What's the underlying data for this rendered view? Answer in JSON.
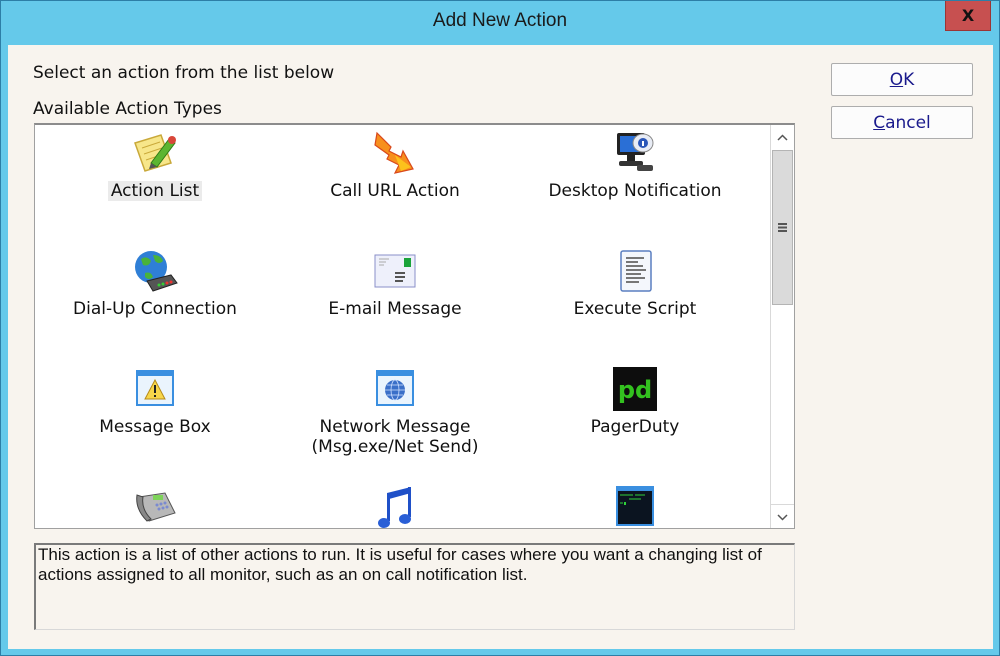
{
  "window": {
    "title": "Add New Action",
    "close_label": "X"
  },
  "instructions": "Select an action from the list below",
  "list_label": "Available Action Types",
  "buttons": {
    "ok": {
      "accel": "O",
      "rest": "K"
    },
    "cancel": {
      "accel": "C",
      "rest": "ancel"
    }
  },
  "actions": [
    {
      "label": "Action List",
      "icon": "notepad-pencil-icon",
      "selected": true
    },
    {
      "label": "Call URL Action",
      "icon": "lightning-arrow-icon"
    },
    {
      "label": "Desktop Notification",
      "icon": "monitor-info-icon"
    },
    {
      "label": "Dial-Up Connection",
      "icon": "globe-modem-icon"
    },
    {
      "label": "E-mail Message",
      "icon": "envelope-icon"
    },
    {
      "label": "Execute Script",
      "icon": "script-document-icon"
    },
    {
      "label": "Message Box",
      "icon": "warning-window-icon"
    },
    {
      "label": "Network Message\n(Msg.exe/Net Send)",
      "icon": "globe-window-icon"
    },
    {
      "label": "PagerDuty",
      "icon": "pagerduty-logo-icon"
    },
    {
      "label": "",
      "icon": "telephone-icon"
    },
    {
      "label": "",
      "icon": "music-note-icon"
    },
    {
      "label": "",
      "icon": "console-window-icon"
    }
  ],
  "description": "This action is a list of other actions to run.  It is useful for cases where you want a changing list of actions assigned to all monitor, such as an on call notification list.",
  "scrollbar": {
    "position_fraction": 0.0,
    "visible_fraction": 0.41
  }
}
